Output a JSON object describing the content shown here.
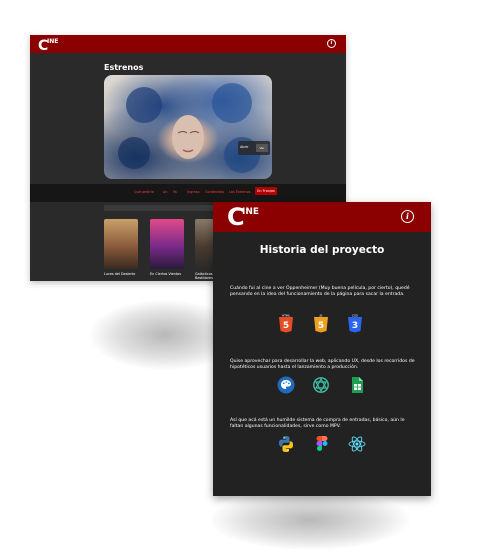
{
  "back": {
    "logo": {
      "c": "C",
      "rest": "INE"
    },
    "info_icon": "i",
    "section_title": "Estrenos",
    "hero_card": {
      "label": "Abrir",
      "button": "Ver"
    },
    "nav": [
      "Qué pedirle",
      "Ah",
      "Ya",
      "Ingreso",
      "Contenidos",
      "Los Estrenos",
      "En Franjas"
    ],
    "posters": [
      {
        "title": "Luces del Desierto",
        "colors": [
          "#c9a06a",
          "#8a5a3a",
          "#3a2a20"
        ]
      },
      {
        "title": "En Ciertos Vientos",
        "colors": [
          "#e04a8a",
          "#7a2a8a",
          "#2a1a3a"
        ]
      },
      {
        "title": "Galácticos en Bastidores",
        "colors": [
          "#8a7a6a",
          "#4a3a30",
          "#2a2a2a"
        ]
      }
    ]
  },
  "front": {
    "logo": {
      "c": "C",
      "rest": "INE"
    },
    "info_icon": "i",
    "title": "Historia del proyecto",
    "paragraphs": [
      "Cuándo fui al cine a ver Oppenheimer (Muy buena película, por cierto), quedé pensando en la idea del funcionamiento de la página para sacar la entrada.",
      "Quise aprovechar para desarrollar la web, aplicando UX, desde los recorridos de hipotéticos usuarios hasta el lanzamiento a producción.",
      "Así que acá está un humilde sistema de compra de entradas, básico, aún le faltan algunas funcionalidades, sirve como MPV."
    ],
    "icons_row1": [
      {
        "name": "html5-icon",
        "label": "HTML",
        "digit": "5",
        "color": "#e44d26"
      },
      {
        "name": "js-icon",
        "label": "JS",
        "digit": "5",
        "color": "#f0a020"
      },
      {
        "name": "css3-icon",
        "label": "CSS",
        "digit": "3",
        "color": "#2965f1"
      }
    ],
    "icons_row2": [
      "palette-icon",
      "openai-icon",
      "sheets-icon"
    ],
    "icons_row3": [
      "python-icon",
      "figma-icon",
      "react-icon"
    ],
    "colors": {
      "brand_red": "#8b0000",
      "panel_bg": "#222222"
    }
  }
}
